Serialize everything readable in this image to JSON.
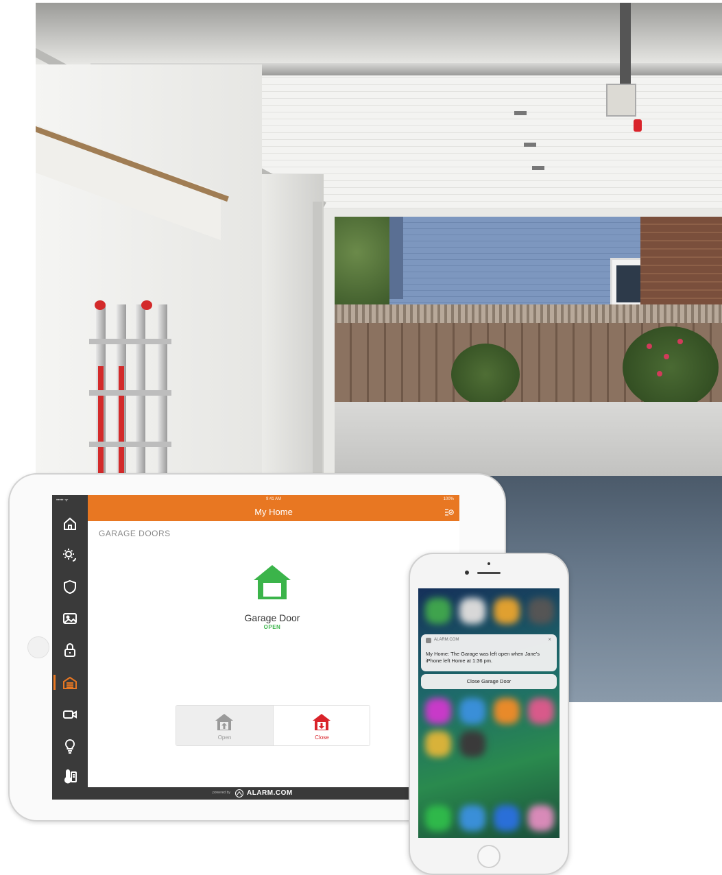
{
  "tablet": {
    "status_time": "9:41 AM",
    "status_battery": "100%",
    "header_title": "My Home",
    "section_title": "GARAGE DOORS",
    "sidebar_items": [
      {
        "name": "home-icon"
      },
      {
        "name": "thermostat-sun-icon"
      },
      {
        "name": "shield-icon"
      },
      {
        "name": "image-icon"
      },
      {
        "name": "lock-icon"
      },
      {
        "name": "garage-icon",
        "active": true
      },
      {
        "name": "video-camera-icon"
      },
      {
        "name": "lightbulb-icon"
      },
      {
        "name": "thermometer-icon"
      }
    ],
    "device": {
      "name": "Garage Door",
      "status": "OPEN",
      "status_color": "#3bb44a"
    },
    "buttons": {
      "open_label": "Open",
      "close_label": "Close"
    },
    "footer": {
      "powered_by": "powered by",
      "brand": "ALARM.COM"
    },
    "accent_color": "#e87722"
  },
  "phone": {
    "notification": {
      "app": "ALARM.COM",
      "message": "My Home: The Garage was left open when Jane's iPhone left Home at 1:36 pm.",
      "action": "Close Garage Door"
    }
  }
}
